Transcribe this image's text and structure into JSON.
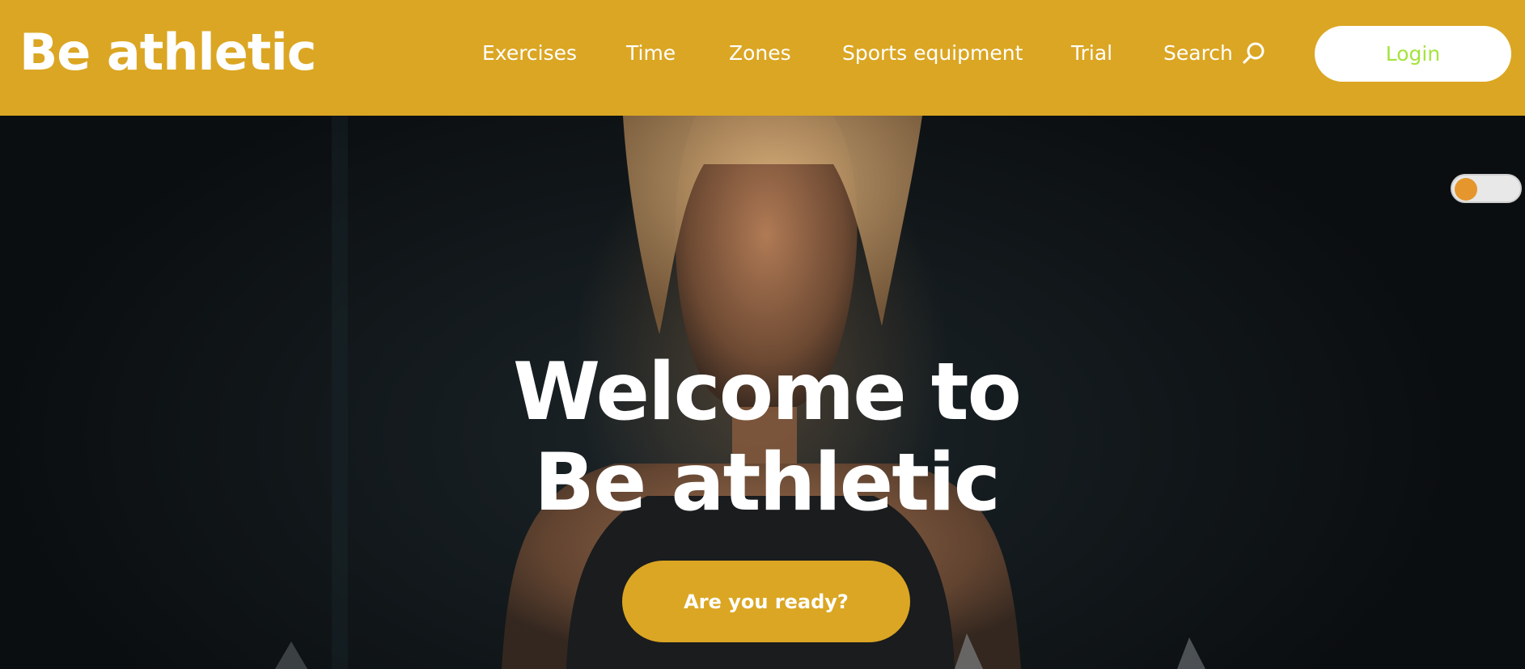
{
  "header": {
    "logo": "Be athletic",
    "nav": [
      {
        "label": "Exercises"
      },
      {
        "label": "Time"
      },
      {
        "label": "Zones"
      },
      {
        "label": "Sports equipment"
      },
      {
        "label": "Trial"
      }
    ],
    "search_label": "Search",
    "login_label": "Login"
  },
  "hero": {
    "title_line1": "Welcome to",
    "title_line2": "Be athletic",
    "cta_label": "Are you ready?"
  },
  "theme_toggle": {
    "state": "off"
  },
  "colors": {
    "brand": "#dba623",
    "login_text": "#a4e43c",
    "toggle_knob": "#e5962d",
    "text_on_brand": "#ffffff"
  },
  "icons": {
    "search": "search-icon"
  }
}
